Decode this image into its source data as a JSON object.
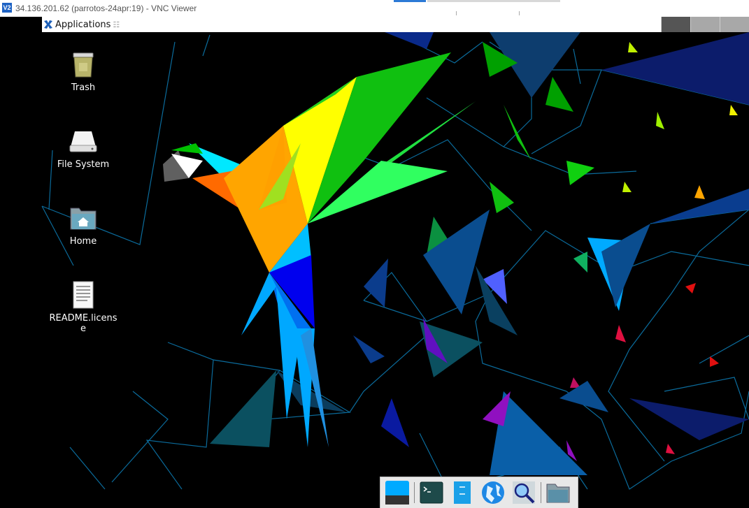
{
  "vnc": {
    "logo": "V2",
    "title": "34.136.201.62 (parrotos-24apr:19) - VNC Viewer"
  },
  "panel": {
    "applications_label": "Applications",
    "applications_suffix": "☷",
    "workspaces": 3,
    "active_workspace": 1
  },
  "desktop": {
    "icons": [
      {
        "label": "Trash",
        "icon": "trash-icon"
      },
      {
        "label": "File System",
        "icon": "drive-icon"
      },
      {
        "label": "Home",
        "icon": "home-folder-icon"
      },
      {
        "label": "README.license",
        "icon": "text-file-icon"
      }
    ]
  },
  "dock": {
    "items": [
      {
        "name": "show-desktop",
        "icon": "desktop-icon"
      },
      {
        "name": "terminal",
        "icon": "terminal-icon"
      },
      {
        "name": "text-editor",
        "icon": "text-editor-icon"
      },
      {
        "name": "web-browser",
        "icon": "browser-globe-icon"
      },
      {
        "name": "search",
        "icon": "search-icon"
      },
      {
        "name": "file-manager",
        "icon": "folder-icon"
      }
    ]
  },
  "colors": {
    "desktop_bg": "#000000",
    "parrot_orange": "#ffa500",
    "parrot_green": "#00c000",
    "parrot_blue": "#0000e0",
    "accent_cyan": "#00bfff"
  }
}
